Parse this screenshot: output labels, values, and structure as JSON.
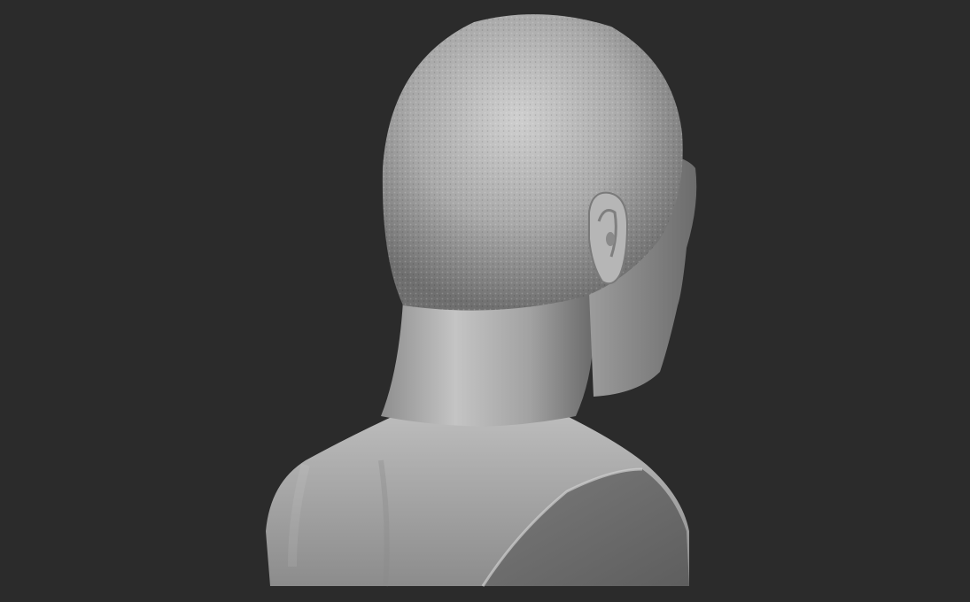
{
  "scene": {
    "background_color": "#2b2b2b",
    "subject": "sculpted-male-bust-rear-view",
    "material_color": "#a8a8a8"
  }
}
